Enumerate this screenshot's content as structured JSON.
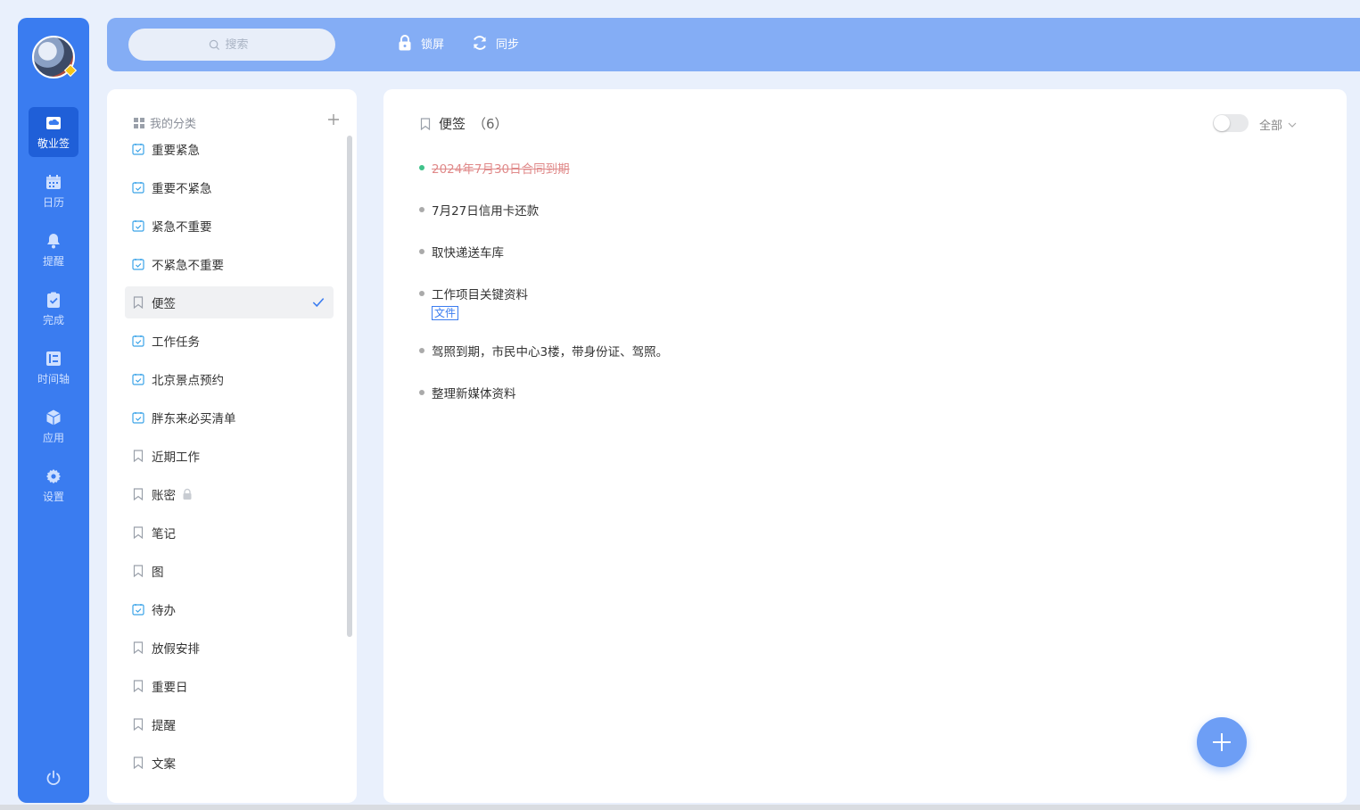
{
  "colors": {
    "primary": "#3a7cf0",
    "topbar": "#84adf5",
    "done_dot": "#3fc28a",
    "strike": "#e08a8a"
  },
  "nav": {
    "items": [
      {
        "label": "敬业签",
        "icon": "cloud-note-icon",
        "active": true
      },
      {
        "label": "日历",
        "icon": "calendar-icon"
      },
      {
        "label": "提醒",
        "icon": "bell-icon"
      },
      {
        "label": "完成",
        "icon": "clipboard-check-icon"
      },
      {
        "label": "时间轴",
        "icon": "timeline-icon"
      },
      {
        "label": "应用",
        "icon": "cube-icon"
      },
      {
        "label": "设置",
        "icon": "gear-icon"
      }
    ]
  },
  "topbar": {
    "search_placeholder": "搜索",
    "lock_label": "锁屏",
    "sync_label": "同步"
  },
  "categories": {
    "header": "我的分类",
    "items": [
      {
        "label": "重要紧急",
        "icon": "check-calendar-icon"
      },
      {
        "label": "重要不紧急",
        "icon": "check-calendar-icon"
      },
      {
        "label": "紧急不重要",
        "icon": "check-calendar-icon"
      },
      {
        "label": "不紧急不重要",
        "icon": "check-calendar-icon"
      },
      {
        "label": "便签",
        "icon": "bookmark-icon",
        "selected": true
      },
      {
        "label": "工作任务",
        "icon": "check-calendar-icon"
      },
      {
        "label": "北京景点预约",
        "icon": "check-calendar-icon"
      },
      {
        "label": "胖东来必买清单",
        "icon": "check-calendar-icon"
      },
      {
        "label": "近期工作",
        "icon": "bookmark-icon"
      },
      {
        "label": "账密",
        "icon": "bookmark-icon",
        "locked": true
      },
      {
        "label": "笔记",
        "icon": "bookmark-icon"
      },
      {
        "label": "图",
        "icon": "bookmark-icon"
      },
      {
        "label": "待办",
        "icon": "check-calendar-icon"
      },
      {
        "label": "放假安排",
        "icon": "bookmark-icon"
      },
      {
        "label": "重要日",
        "icon": "bookmark-icon"
      },
      {
        "label": "提醒",
        "icon": "bookmark-icon"
      },
      {
        "label": "文案",
        "icon": "bookmark-icon"
      }
    ]
  },
  "main": {
    "title": "便签",
    "count": "（6）",
    "filter_label": "全部",
    "notes": [
      {
        "text": "2024年7月30日合同到期",
        "done": true
      },
      {
        "text": "7月27日信用卡还款"
      },
      {
        "text": "取快递送车库"
      },
      {
        "text": "工作项目关键资料",
        "tag": "文件"
      },
      {
        "text": "驾照到期，市民中心3楼，带身份证、驾照。"
      },
      {
        "text": "整理新媒体资料"
      }
    ]
  }
}
